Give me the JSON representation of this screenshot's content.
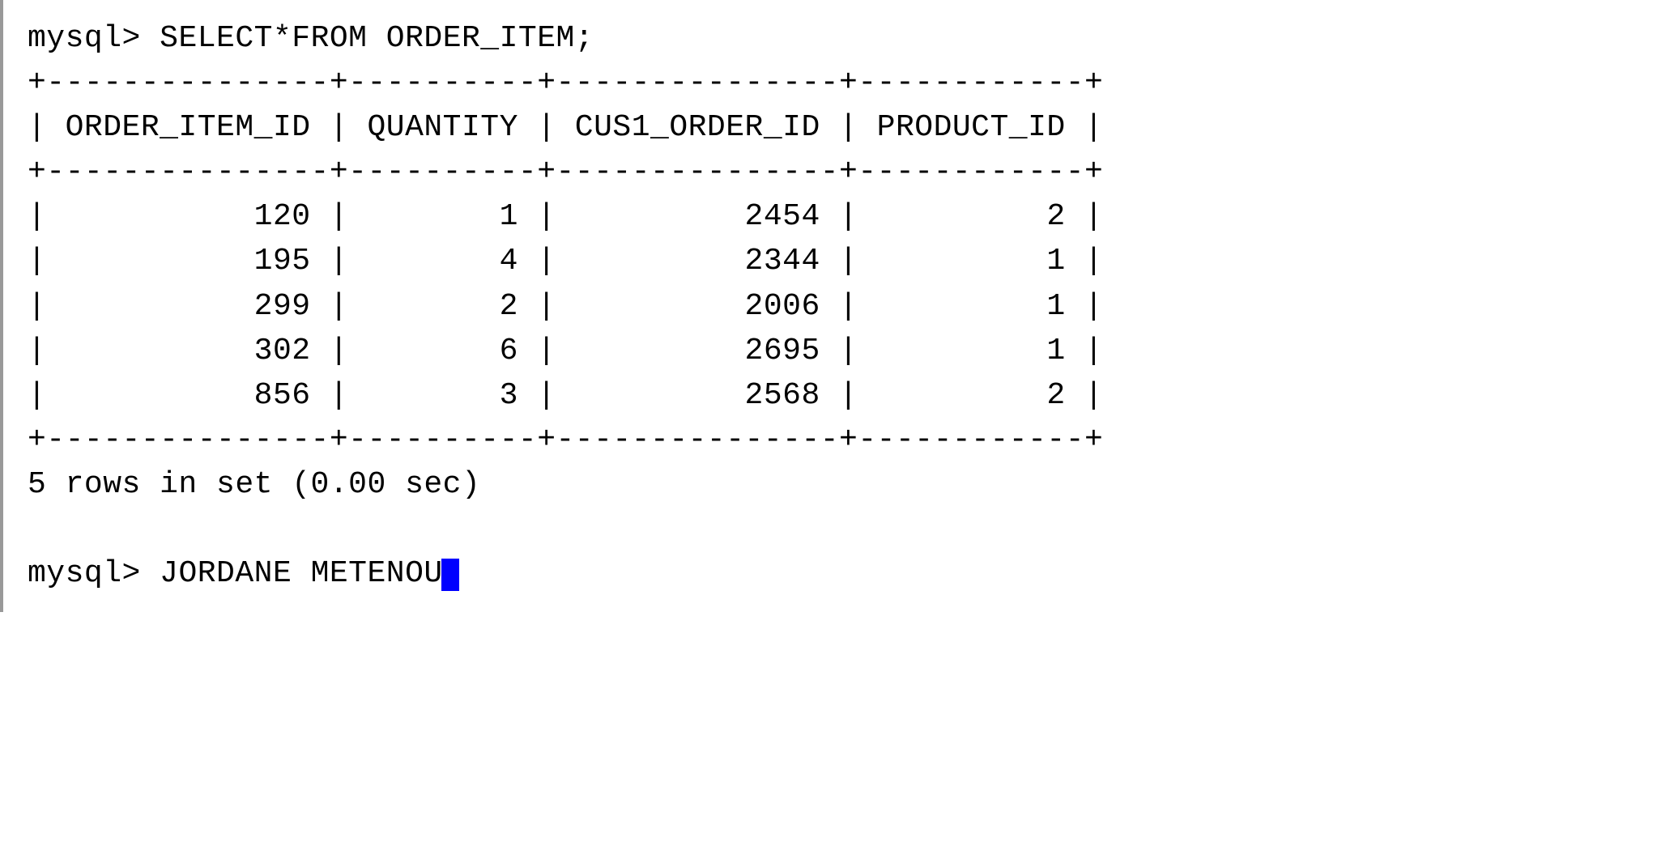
{
  "prompt1": "mysql>",
  "query": "SELECT*FROM ORDER_ITEM;",
  "border_top": "+---------------+----------+---------------+------------+",
  "header_line": "| ORDER_ITEM_ID | QUANTITY | CUS1_ORDER_ID | PRODUCT_ID |",
  "border_mid": "+---------------+----------+---------------+------------+",
  "rows": [
    "|           120 |        1 |          2454 |          2 |",
    "|           195 |        4 |          2344 |          1 |",
    "|           299 |        2 |          2006 |          1 |",
    "|           302 |        6 |          2695 |          1 |",
    "|           856 |        3 |          2568 |          2 |"
  ],
  "border_bot": "+---------------+----------+---------------+------------+",
  "status": "5 rows in set (0.00 sec)",
  "prompt2": "mysql>",
  "input_text": "JORDANE METENOU",
  "chart_data": {
    "type": "table",
    "columns": [
      "ORDER_ITEM_ID",
      "QUANTITY",
      "CUS1_ORDER_ID",
      "PRODUCT_ID"
    ],
    "data": [
      [
        120,
        1,
        2454,
        2
      ],
      [
        195,
        4,
        2344,
        1
      ],
      [
        299,
        2,
        2006,
        1
      ],
      [
        302,
        6,
        2695,
        1
      ],
      [
        856,
        3,
        2568,
        2
      ]
    ],
    "row_count": 5,
    "query_time_sec": 0.0
  }
}
